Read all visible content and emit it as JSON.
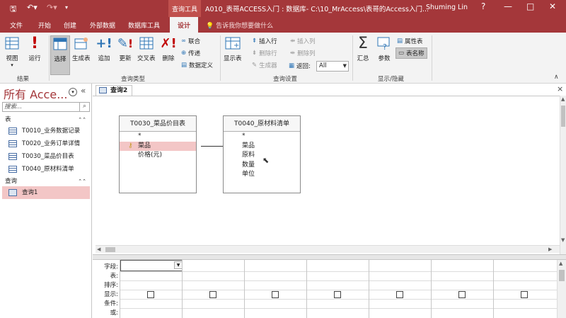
{
  "titlebar": {
    "tool_tab": "查询工具",
    "title": "A010_表哥ACCESS入门 : 数据库- C:\\10_MrAccess\\表哥的Access入门...",
    "user": "Shuming Lin",
    "help": "?",
    "minimize": "—",
    "restore": "□",
    "close": "✕"
  },
  "tabs": [
    "文件",
    "开始",
    "创建",
    "外部数据",
    "数据库工具",
    "设计"
  ],
  "tellme": "告诉我你想要做什么",
  "ribbon": {
    "view": "视图",
    "run": "运行",
    "select": "选择",
    "maketable": "生成表",
    "append": "追加",
    "update": "更新",
    "crosstab": "交叉表",
    "delete": "删除",
    "union": "联合",
    "passthrough": "传递",
    "datadef": "数据定义",
    "showtable": "显示表",
    "insert_rows": "插入行",
    "delete_rows": "删除行",
    "builder": "生成器",
    "insert_cols": "插入列",
    "delete_cols": "删除列",
    "return_label": "返回:",
    "return_value": "All",
    "totals": "汇总",
    "params": "参数",
    "propsheet": "属性表",
    "tablenames": "表名称",
    "groups": {
      "results": "结果",
      "querytype": "查询类型",
      "querysetup": "查询设置",
      "showhide": "显示/隐藏"
    }
  },
  "nav": {
    "title": "所有 Acce...",
    "search_placeholder": "搜索...",
    "sections": {
      "tables": "表",
      "queries": "查询"
    },
    "tables": [
      "T0010_业务数据记录",
      "T0020_业务订单详情",
      "T0030_菜品价目表",
      "T0040_原材料清单"
    ],
    "queries": [
      "查询1"
    ]
  },
  "doc": {
    "tab": "查询2",
    "close": "×"
  },
  "tables": [
    {
      "name": "T0030_菜品价目表",
      "fields": [
        "*",
        "菜品",
        "价格(元)"
      ]
    },
    {
      "name": "T0040_原材料清单",
      "fields": [
        "*",
        "菜品",
        "原料",
        "数量",
        "单位"
      ]
    }
  ],
  "grid": {
    "row_labels": [
      "字段:",
      "表:",
      "排序:",
      "显示:",
      "条件:",
      "或:"
    ]
  }
}
